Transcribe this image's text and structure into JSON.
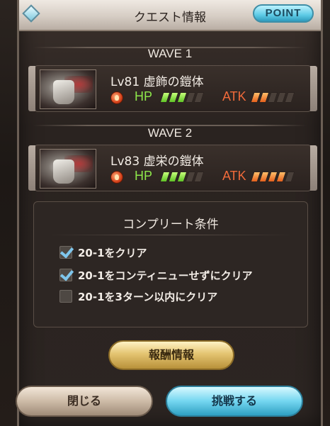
{
  "header": {
    "title": "クエスト情報",
    "point_label": "POINT"
  },
  "waves": [
    {
      "label": "WAVE 1",
      "enemy": {
        "name": "Lv81 虚飾の鎧体",
        "hp_label": "HP",
        "atk_label": "ATK",
        "hp_level": 3,
        "atk_level": 2,
        "max_level": 5
      }
    },
    {
      "label": "WAVE 2",
      "enemy": {
        "name": "Lv83 虚栄の鎧体",
        "hp_label": "HP",
        "atk_label": "ATK",
        "hp_level": 3,
        "atk_level": 4,
        "max_level": 5
      }
    }
  ],
  "conditions": {
    "title": "コンプリート条件",
    "items": [
      {
        "text": "20-1をクリア",
        "checked": true
      },
      {
        "text": "20-1をコンティニューせずにクリア",
        "checked": true
      },
      {
        "text": "20-1を3ターン以内にクリア",
        "checked": false
      }
    ]
  },
  "buttons": {
    "reward": "報酬情報",
    "close": "閉じる",
    "challenge": "挑戦する"
  }
}
